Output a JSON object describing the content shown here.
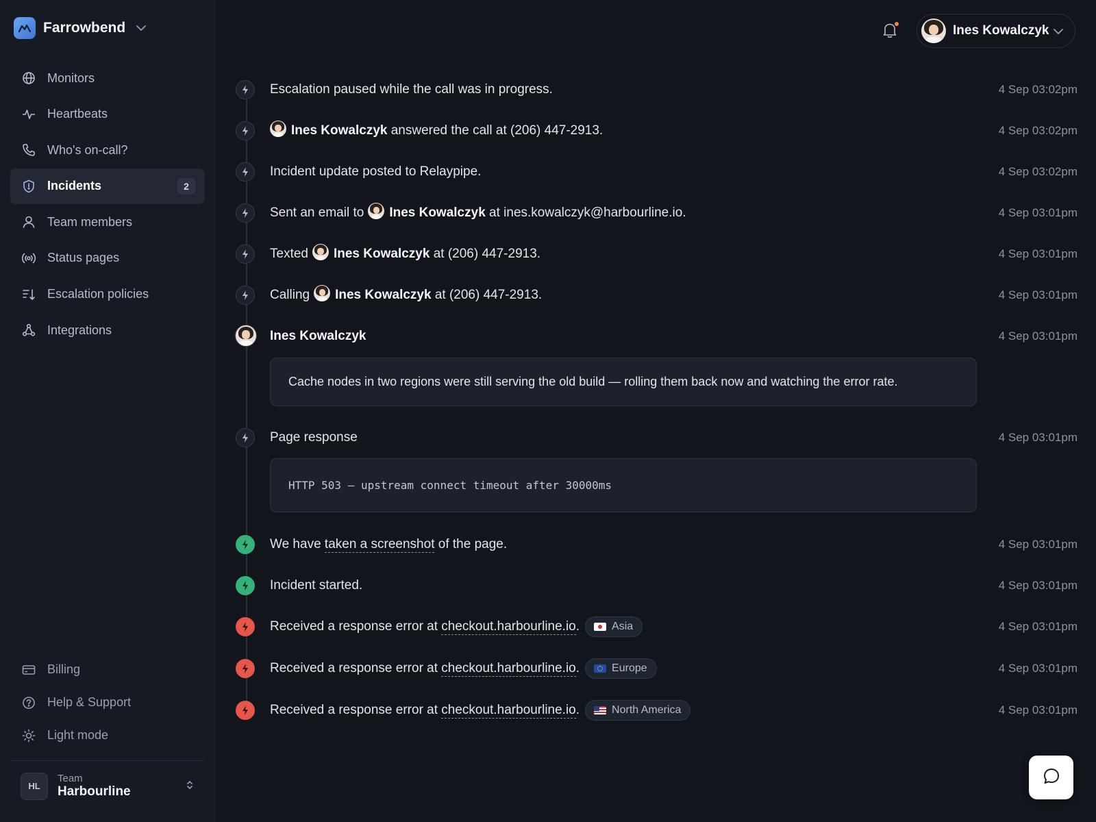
{
  "brand": {
    "name": "Farrowbend"
  },
  "nav": {
    "items": [
      {
        "label": "Monitors",
        "icon": "globe-icon"
      },
      {
        "label": "Heartbeats",
        "icon": "pulse-icon"
      },
      {
        "label": "Who's on-call?",
        "icon": "phone-icon"
      },
      {
        "label": "Incidents",
        "icon": "shield-icon",
        "badge": "2",
        "active": true
      },
      {
        "label": "Team members",
        "icon": "user-icon"
      },
      {
        "label": "Status pages",
        "icon": "broadcast-icon"
      },
      {
        "label": "Escalation policies",
        "icon": "sort-icon"
      },
      {
        "label": "Integrations",
        "icon": "nodes-icon"
      }
    ],
    "bottom": [
      {
        "label": "Billing",
        "icon": "card-icon"
      },
      {
        "label": "Help & Support",
        "icon": "help-icon"
      },
      {
        "label": "Light mode",
        "icon": "sun-icon"
      }
    ]
  },
  "team": {
    "initials": "HL",
    "label": "Team",
    "name": "Harbourline"
  },
  "header": {
    "user_name": "Ines Kowalczyk"
  },
  "timeline": {
    "e1": {
      "text": "Escalation paused while the call was in progress.",
      "time": "4 Sep 03:02pm"
    },
    "e2": {
      "person": "Ines Kowalczyk",
      "text": " answered the call at (206) 447-2913.",
      "time": "4 Sep 03:02pm"
    },
    "e3": {
      "text": "Incident update posted to Relaypipe.",
      "time": "4 Sep 03:02pm"
    },
    "e4": {
      "prefix": "Sent an email to",
      "person": "Ines Kowalczyk",
      "suffix": " at ines.kowalczyk@harbourline.io.",
      "time": "4 Sep 03:01pm"
    },
    "e5": {
      "prefix": "Texted",
      "person": "Ines Kowalczyk",
      "suffix": " at (206) 447-2913.",
      "time": "4 Sep 03:01pm"
    },
    "e6": {
      "prefix": "Calling",
      "person": "Ines Kowalczyk",
      "suffix": " at (206) 447-2913.",
      "time": "4 Sep 03:01pm"
    },
    "e7": {
      "person": "Ines Kowalczyk",
      "message": "Cache nodes in two regions were still serving the old build — rolling them back now and watching the error rate.",
      "time": "4 Sep 03:01pm"
    },
    "e8": {
      "text": "Page response",
      "code": "HTTP 503 — upstream connect timeout after 30000ms",
      "time": "4 Sep 03:01pm"
    },
    "e9": {
      "prefix": "We have ",
      "link": "taken a screenshot",
      "suffix": " of the page.",
      "time": "4 Sep 03:01pm",
      "status_color": "#35b27a"
    },
    "e10": {
      "text": "Incident started.",
      "time": "4 Sep 03:01pm",
      "status_color": "#35b27a"
    },
    "e11": {
      "prefix": "Received a response error at ",
      "link": "checkout.harbourline.io",
      "suffix": ".",
      "region": "Asia",
      "time": "4 Sep 03:01pm",
      "status_color": "#e4574a"
    },
    "e12": {
      "prefix": "Received a response error at ",
      "link": "checkout.harbourline.io",
      "suffix": ".",
      "region": "Europe",
      "time": "4 Sep 03:01pm",
      "status_color": "#e4574a"
    },
    "e13": {
      "prefix": "Received a response error at ",
      "link": "checkout.harbourline.io",
      "suffix": ".",
      "region": "North America",
      "time": "4 Sep 03:01pm",
      "status_color": "#e4574a"
    }
  }
}
